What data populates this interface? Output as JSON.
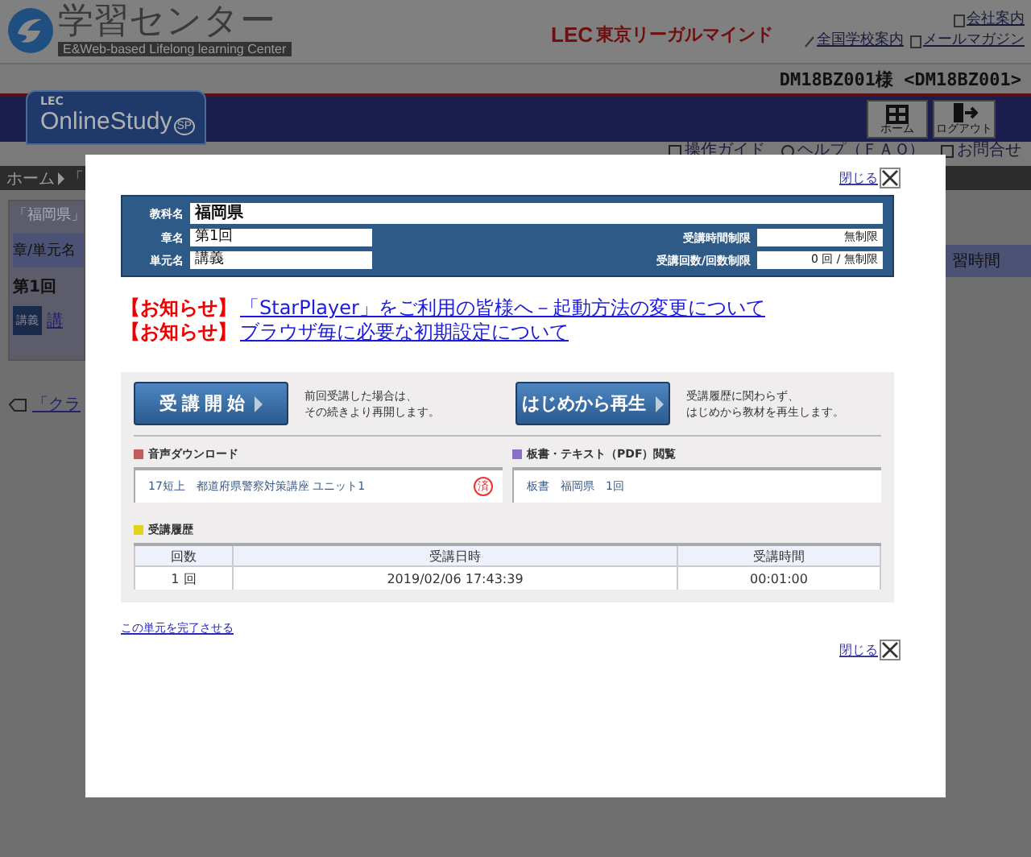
{
  "header": {
    "logo_title": "学習センター",
    "logo_subtitle": "E&Web-based Lifelong learning Center",
    "brand_mark": "LEC",
    "brand_name": "東京リーガルマインド",
    "links": [
      {
        "label": "会社案内",
        "kind": "company"
      },
      {
        "label": "全国学校案内",
        "kind": "schools"
      },
      {
        "label": "メールマガジン",
        "kind": "mail"
      }
    ]
  },
  "user": "DM18BZ001様 <DM18BZ001>",
  "nav": {
    "logo_top": "LEC",
    "logo_main": "OnlineStudy",
    "logo_badge": "SP",
    "buttons": [
      {
        "label": "ホーム",
        "kind": "home"
      },
      {
        "label": "ログアウト",
        "kind": "logout"
      }
    ]
  },
  "help_links": [
    {
      "label": "操作ガイド",
      "kind": "guide"
    },
    {
      "label": "ヘルプ（ＦＡＱ）",
      "kind": "help"
    },
    {
      "label": "お問合せ",
      "kind": "mail"
    }
  ],
  "background_page": {
    "breadcrumb": "ホーム",
    "breadcrumb_next": "「",
    "panel_title": "「福岡県」",
    "column_header": "章/単元名",
    "row_title": "第1回",
    "lecture_badge": "講義",
    "lecture_link": "講",
    "class_link": "「クラ",
    "column_header_right": "習時間"
  },
  "modal": {
    "close_top": "閉じる",
    "subject": {
      "label": "教科名",
      "value": "福岡県"
    },
    "info_rows": [
      {
        "label": "章名",
        "value": "第1回",
        "limit_label": "受講時間制限",
        "limit_value": "無制限"
      },
      {
        "label": "単元名",
        "value": "講義",
        "limit_label": "受講回数/回数制限",
        "limit_value": "0 回 / 無制限"
      }
    ],
    "notices": [
      {
        "tag": "【お知らせ】",
        "text": "「StarPlayer」をご利用の皆様へ－起動方法の変更について"
      },
      {
        "tag": "【お知らせ】",
        "text": "ブラウザ毎に必要な初期設定について"
      }
    ],
    "actions": [
      {
        "label": "受 講 開 始",
        "note_lines": [
          "前回受講した場合は、",
          "その続きより再開します。"
        ]
      },
      {
        "label": "はじめから再生",
        "note_lines": [
          "受講履歴に関わらず、",
          "はじめから教材を再生します。"
        ]
      }
    ],
    "sections": [
      {
        "title": "音声ダウンロード",
        "color": "#c45a5a",
        "item": "17短上　都道府県警察対策講座 ユニット1",
        "done_mark": "済"
      },
      {
        "title": "板書・テキスト（PDF）閲覧",
        "color": "#8a6fc8",
        "item": "板書　福岡県　1回"
      }
    ],
    "history": {
      "title": "受講履歴",
      "color": "#e0d41a",
      "columns": [
        "回数",
        "受講日時",
        "受講時間"
      ],
      "rows": [
        [
          "1 回",
          "2019/02/06 17:43:39",
          "00:01:00"
        ]
      ]
    },
    "complete_link": "この単元を完了させる",
    "close_bottom": "閉じる"
  }
}
